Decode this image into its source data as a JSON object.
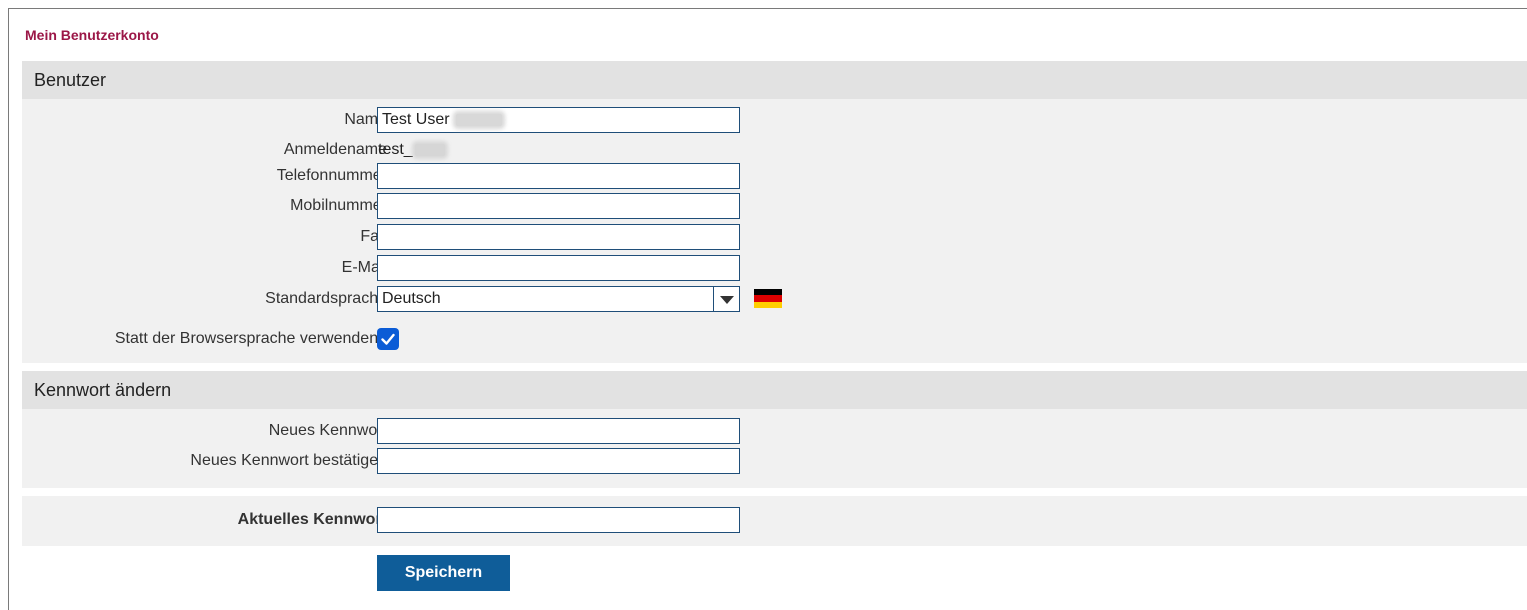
{
  "page": {
    "title": "Mein Benutzerkonto"
  },
  "user_section": {
    "header": "Benutzer",
    "name": {
      "label": "Name",
      "value": "Test User"
    },
    "login": {
      "label": "Anmeldename",
      "value": "test_"
    },
    "phone": {
      "label": "Telefonnummer",
      "value": ""
    },
    "mobile": {
      "label": "Mobilnummer",
      "value": ""
    },
    "fax": {
      "label": "Fax",
      "value": ""
    },
    "email": {
      "label": "E-Mail",
      "value": ""
    },
    "language": {
      "label": "Standardsprache",
      "selected": "Deutsch",
      "flag_icon": "german-flag-icon"
    },
    "use_instead": {
      "label": "Statt der Browsersprache verwenden?",
      "checked": true
    }
  },
  "password_section": {
    "header": "Kennwort ändern",
    "new_password": {
      "label": "Neues Kennwort",
      "value": ""
    },
    "confirm_password": {
      "label": "Neues Kennwort bestätigen",
      "value": ""
    }
  },
  "current_password": {
    "label": "Aktuelles Kennwort",
    "value": ""
  },
  "actions": {
    "save_label": "Speichern"
  },
  "colors": {
    "title": "#9b1747",
    "button": "#0f5d99",
    "checkbox": "#0b5cd6",
    "border": "#1f4e79"
  }
}
